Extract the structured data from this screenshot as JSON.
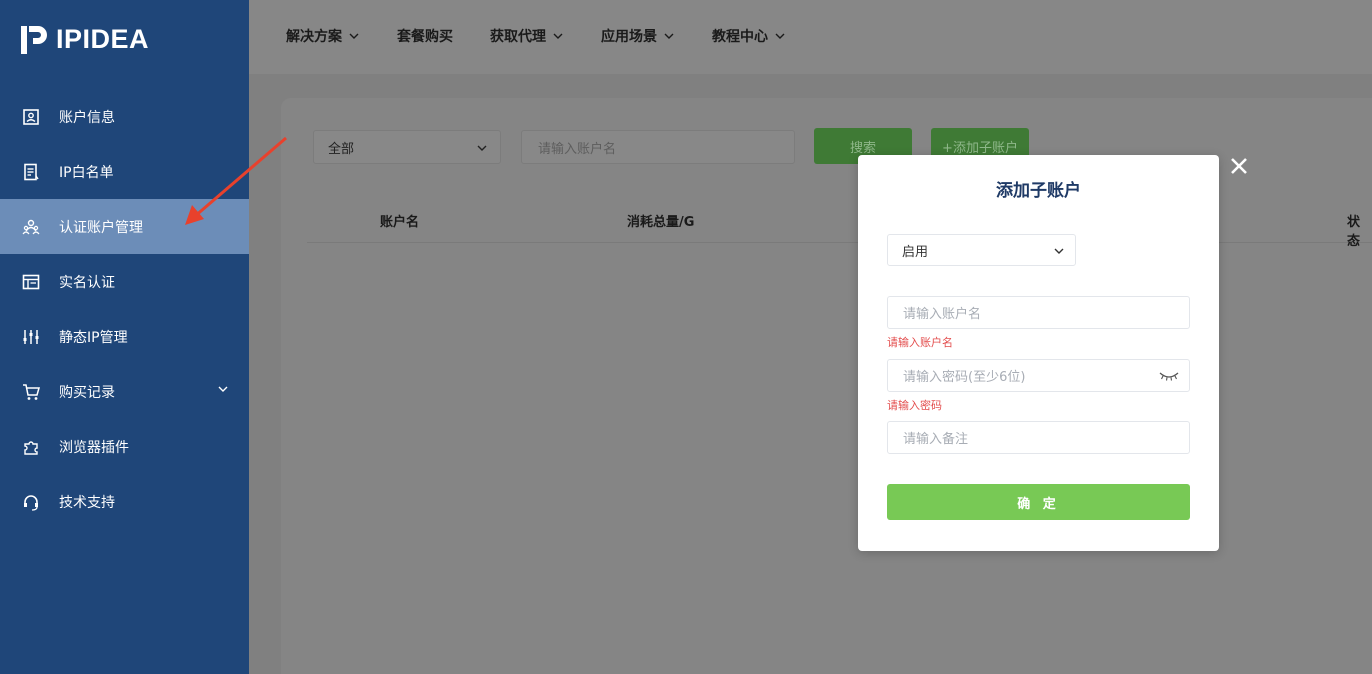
{
  "brand": {
    "name": "IPIDEA"
  },
  "sidebar": {
    "items": [
      {
        "label": "账户信息",
        "icon": "account-info-icon",
        "active": false
      },
      {
        "label": "IP白名单",
        "icon": "whitelist-icon",
        "active": false
      },
      {
        "label": "认证账户管理",
        "icon": "users-icon",
        "active": true
      },
      {
        "label": "实名认证",
        "icon": "id-card-icon",
        "active": false
      },
      {
        "label": "静态IP管理",
        "icon": "sliders-icon",
        "active": false
      },
      {
        "label": "购买记录",
        "icon": "cart-icon",
        "active": false,
        "has_submenu": true
      },
      {
        "label": "浏览器插件",
        "icon": "puzzle-icon",
        "active": false
      },
      {
        "label": "技术支持",
        "icon": "headset-icon",
        "active": false
      }
    ]
  },
  "topnav": {
    "items": [
      {
        "label": "解决方案",
        "dropdown": true
      },
      {
        "label": "套餐购买",
        "dropdown": false
      },
      {
        "label": "获取代理",
        "dropdown": true
      },
      {
        "label": "应用场景",
        "dropdown": true
      },
      {
        "label": "教程中心",
        "dropdown": true
      }
    ]
  },
  "filters": {
    "status_select": "全部",
    "account_placeholder": "请输入账户名",
    "search_label": "搜索",
    "add_label": "+添加子账户"
  },
  "table": {
    "columns": [
      "账户名",
      "消耗总量/G",
      "状态"
    ]
  },
  "modal": {
    "title": "添加子账户",
    "status_value": "启用",
    "account_placeholder": "请输入账户名",
    "account_error": "请输入账户名",
    "password_placeholder": "请输入密码(至少6位)",
    "password_error": "请输入密码",
    "remark_placeholder": "请输入备注",
    "confirm_label": "确 定"
  },
  "colors": {
    "sidebar_bg": "#1f4679",
    "sidebar_active": "#6c8db8",
    "confirm_green": "#78c955",
    "error_red": "#e34d4d",
    "arrow_red": "#e8412c"
  }
}
